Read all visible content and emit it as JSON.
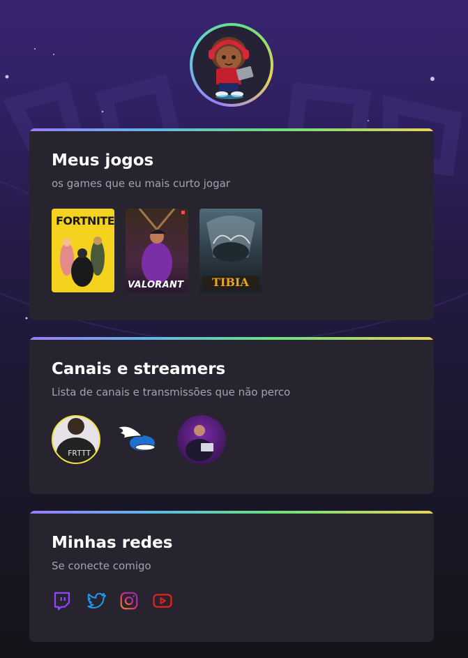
{
  "profile": {
    "avatar_alt": "avatar"
  },
  "games_card": {
    "title": "Meus jogos",
    "subtitle": "os games que eu mais curto jogar",
    "games": [
      {
        "name": "FORTNITE"
      },
      {
        "name": "VALORANT"
      },
      {
        "name": "TIBIA"
      }
    ]
  },
  "streamers_card": {
    "title": "Canais e streamers",
    "subtitle": "Lista de canais e transmissões que não perco",
    "streamers": [
      {
        "caption": "FRTTT"
      },
      {
        "caption": ""
      },
      {
        "caption": ""
      }
    ]
  },
  "socials_card": {
    "title": "Minhas redes",
    "subtitle": "Se conecte comigo",
    "networks": [
      {
        "icon": "twitch-icon",
        "color": "#9146ff"
      },
      {
        "icon": "twitter-icon",
        "color": "#1d9bf0"
      },
      {
        "icon": "instagram-icon",
        "color": "#e1306c"
      },
      {
        "icon": "youtube-icon",
        "color": "#e62117"
      }
    ]
  },
  "theme": {
    "accent_gradient": [
      "#9a7bff",
      "#5fb8e8",
      "#6be07f",
      "#e6d35a"
    ],
    "card_bg": "#27232f",
    "subtitle_color": "#a7a2b3"
  }
}
